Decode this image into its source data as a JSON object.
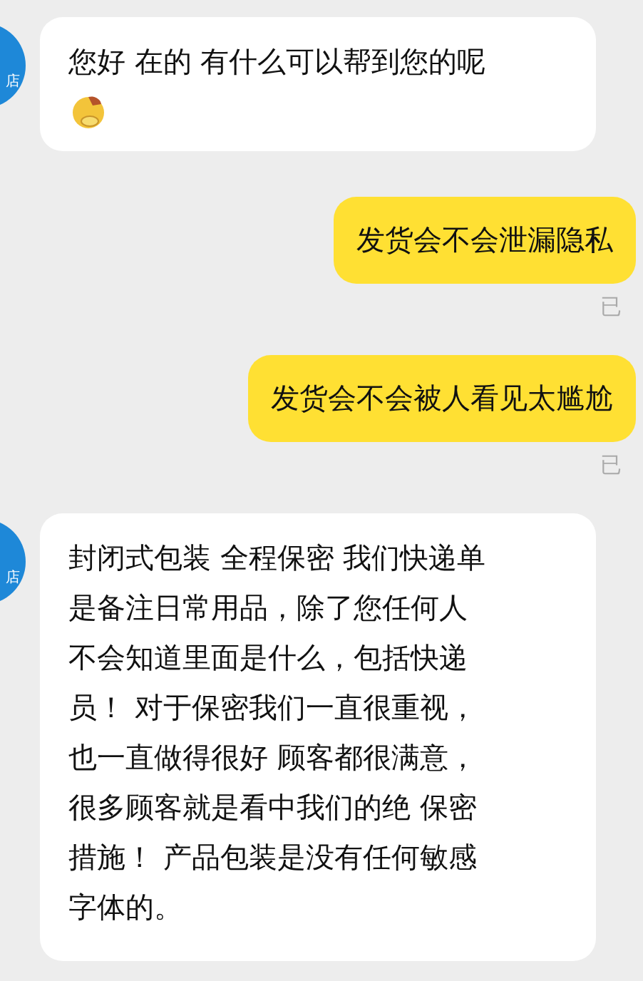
{
  "messages": [
    {
      "kind": "incoming",
      "avatar_text": "店",
      "lines": [
        "您好 在的 有什么可以帮到您的呢"
      ],
      "emoji": true
    },
    {
      "kind": "outgoing",
      "lines": [
        "发货会不会泄漏隐私"
      ],
      "status": "已"
    },
    {
      "kind": "outgoing",
      "lines": [
        "发货会不会被人看见太尴尬"
      ],
      "status": "已"
    },
    {
      "kind": "incoming",
      "avatar_text": "店",
      "lines": [
        "封闭式包装 全程保密 我们快递单",
        "是备注日常用品，除了您任何人",
        "不会知道里面是什么，包括快递",
        "员！ 对于保密我们一直很重视，",
        "也一直做得很好 顾客都很满意，",
        "很多顾客就是看中我们的绝 保密",
        "措施！ 产品包装是没有任何敏感",
        "字体的。"
      ],
      "emoji": false
    }
  ]
}
